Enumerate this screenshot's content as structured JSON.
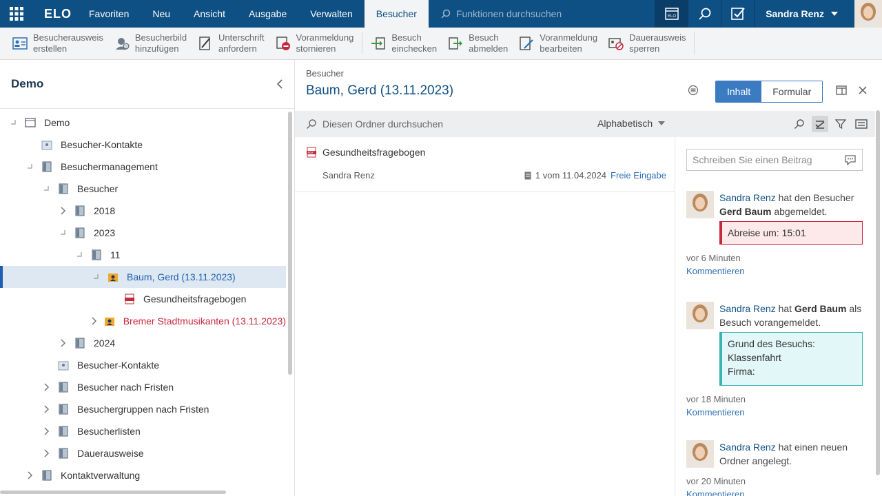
{
  "app": {
    "logo": "ELO"
  },
  "menu": {
    "items": [
      "Favoriten",
      "Neu",
      "Ansicht",
      "Ausgabe",
      "Verwalten",
      "Besucher"
    ],
    "active_index": 5
  },
  "top_search": {
    "placeholder": "Funktionen durchsuchen"
  },
  "user": {
    "name": "Sandra Renz"
  },
  "ribbon": {
    "buttons": [
      {
        "line1": "Besucherausweis",
        "line2": "erstellen",
        "icon": "visitor-badge-icon"
      },
      {
        "line1": "Besucherbild",
        "line2": "hinzufügen",
        "icon": "visitor-photo-icon"
      },
      {
        "line1": "Unterschrift",
        "line2": "anfordern",
        "icon": "signature-icon"
      },
      {
        "line1": "Voranmeldung",
        "line2": "stornieren",
        "icon": "cancel-registration-icon"
      },
      {
        "line1": "Besuch",
        "line2": "einchecken",
        "icon": "check-in-icon"
      },
      {
        "line1": "Besuch",
        "line2": "abmelden",
        "icon": "check-out-icon"
      },
      {
        "line1": "Voranmeldung",
        "line2": "bearbeiten",
        "icon": "edit-registration-icon"
      },
      {
        "line1": "Dauerausweis",
        "line2": "sperren",
        "icon": "lock-badge-icon"
      }
    ]
  },
  "left_panel": {
    "title": "Demo",
    "tree": [
      {
        "label": "Demo",
        "level": 0,
        "toggle": "collapse",
        "icon": "elo-archive-icon"
      },
      {
        "label": "Besucher-Kontakte",
        "level": 1,
        "toggle": "none",
        "icon": "contacts-folder-icon"
      },
      {
        "label": "Besuchermanagement",
        "level": 1,
        "toggle": "collapse",
        "icon": "folder-icon"
      },
      {
        "label": "Besucher",
        "level": 2,
        "toggle": "collapse",
        "icon": "folder-icon"
      },
      {
        "label": "2018",
        "level": 3,
        "toggle": "expand",
        "icon": "folder-icon"
      },
      {
        "label": "2023",
        "level": 3,
        "toggle": "collapse",
        "icon": "folder-icon"
      },
      {
        "label": "11",
        "level": 4,
        "toggle": "collapse",
        "icon": "folder-icon"
      },
      {
        "label": "Baum, Gerd (13.11.2023)",
        "level": 5,
        "toggle": "collapse",
        "icon": "visitor-folder-icon",
        "selected": true
      },
      {
        "label": "Gesundheitsfragebogen",
        "level": 6,
        "toggle": "none",
        "icon": "pdf-icon"
      },
      {
        "label": "Bremer Stadtmusikanten (13.11.2023)",
        "level": 5,
        "toggle": "expand",
        "icon": "visitor-group-icon",
        "color": "red"
      },
      {
        "label": "2024",
        "level": 3,
        "toggle": "expand",
        "icon": "folder-icon"
      },
      {
        "label": "Besucher-Kontakte",
        "level": 2,
        "toggle": "none",
        "icon": "contacts-folder-icon"
      },
      {
        "label": "Besucher nach Fristen",
        "level": 2,
        "toggle": "expand",
        "icon": "folder-icon"
      },
      {
        "label": "Besuchergruppen nach Fristen",
        "level": 2,
        "toggle": "expand",
        "icon": "folder-icon"
      },
      {
        "label": "Besucherlisten",
        "level": 2,
        "toggle": "expand",
        "icon": "folder-icon"
      },
      {
        "label": "Dauerausweise",
        "level": 2,
        "toggle": "expand",
        "icon": "folder-icon"
      },
      {
        "label": "Kontaktverwaltung",
        "level": 1,
        "toggle": "expand",
        "icon": "folder-icon"
      }
    ]
  },
  "content": {
    "breadcrumb": "Besucher",
    "title": "Baum, Gerd (13.11.2023)",
    "tab_content": "Inhalt",
    "tab_form": "Formular",
    "list_search_placeholder": "Diesen Ordner durchsuchen",
    "sort": "Alphabetisch",
    "documents": [
      {
        "name": "Gesundheitsfragebogen",
        "owner": "Sandra Renz",
        "version": "1 vom 11.04.2024",
        "link": "Freie Eingabe"
      }
    ]
  },
  "feed": {
    "input_placeholder": "Schreiben Sie einen Beitrag",
    "entries": [
      {
        "name": "Sandra Renz",
        "t1": " hat den Besucher ",
        "bold": "Gerd Baum",
        "t2": " abgemeldet.",
        "note": [
          "Abreise um: 15:01"
        ],
        "note_type": "red",
        "time": "vor 6 Minuten",
        "comment": "Kommentieren"
      },
      {
        "name": "Sandra Renz",
        "t1": " hat ",
        "bold": "Gerd Baum",
        "t2": " als Besuch vorangemeldet.",
        "note": [
          "Grund des Besuchs:",
          "Klassenfahrt",
          "Firma:"
        ],
        "note_type": "teal",
        "time": "vor 18 Minuten",
        "comment": "Kommentieren"
      },
      {
        "name": "Sandra Renz",
        "t1": " hat einen neuen Ordner angelegt.",
        "bold": "",
        "t2": "",
        "note": [],
        "note_type": "",
        "time": "vor 20 Minuten",
        "comment": "Kommentieren"
      }
    ]
  },
  "colors": {
    "topbar": "#0e4f84",
    "accent": "#3a7bc2",
    "selected_row": "#dde8f3",
    "red_note": "#c6283c",
    "teal_note": "#3cb3b3"
  }
}
